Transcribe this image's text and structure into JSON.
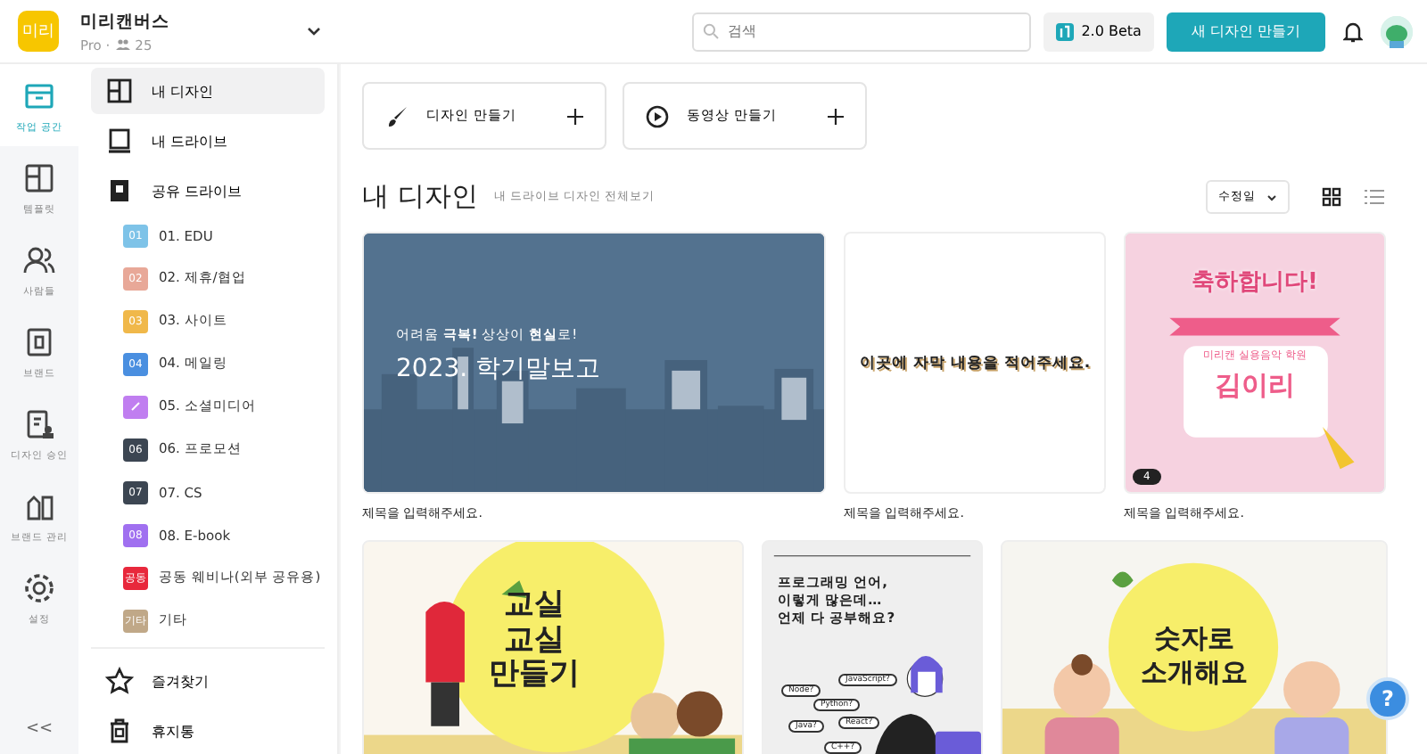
{
  "workspace": {
    "logo": "미리",
    "name": "미리캔버스",
    "plan": "Pro ·",
    "members": "25"
  },
  "header": {
    "search_placeholder": "검색",
    "beta_label": "2.0 Beta",
    "new_design_label": "새 디자인 만들기"
  },
  "rail": [
    {
      "kind": "workspace",
      "label": "작업 공간",
      "selected": true
    },
    {
      "kind": "template",
      "label": "템플릿",
      "selected": false
    },
    {
      "kind": "people",
      "label": "사람들",
      "selected": false
    },
    {
      "kind": "brand",
      "label": "브랜드",
      "selected": false
    },
    {
      "kind": "approval",
      "label": "디자인 승인",
      "selected": false
    },
    {
      "kind": "brandmgmt",
      "label": "브랜드 관리",
      "selected": false
    },
    {
      "kind": "settings",
      "label": "설정",
      "selected": false
    }
  ],
  "rail_collapse": "<<",
  "sidebar": {
    "items": [
      {
        "kind": "design",
        "label": "내 디자인",
        "selected": true
      },
      {
        "kind": "drive",
        "label": "내 드라이브",
        "selected": false
      },
      {
        "kind": "shared",
        "label": "공유 드라이브",
        "selected": false,
        "children": [
          {
            "code": "01",
            "label": "01. EDU",
            "color": "#7ec3e8"
          },
          {
            "code": "02",
            "label": "02. 제휴/협업",
            "color": "#e8a898"
          },
          {
            "code": "03",
            "label": "03. 사이트",
            "color": "#f0b84a"
          },
          {
            "code": "04",
            "label": "04. 메일링",
            "color": "#4a8fe0"
          },
          {
            "label": "05. 소셜미디어",
            "color": "#c07ef0"
          },
          {
            "code": "06",
            "label": "06. 프로모션",
            "color": "#3c4652"
          },
          {
            "code": "07",
            "label": "07. CS",
            "color": "#3c4652"
          },
          {
            "code": "08",
            "label": "08. E-book",
            "color": "#a070f0"
          },
          {
            "code": "공동",
            "label": "공동 웨비나(외부 공유용)",
            "color": "#e8283c"
          },
          {
            "code": "기타",
            "label": "기타",
            "color": "#c0a888"
          }
        ]
      },
      {
        "kind": "favorite",
        "label": "즐겨찾기",
        "selected": false
      },
      {
        "kind": "trash",
        "label": "휴지통",
        "selected": false
      }
    ]
  },
  "create_buttons": [
    {
      "kind": "design",
      "label": "디자인 만들기"
    },
    {
      "kind": "video",
      "label": "동영상 만들기"
    }
  ],
  "section": {
    "title": "내 디자인",
    "link": "내 드라이브 디자인 전체보기",
    "sort": "수정일",
    "views": [
      {
        "kind": "grid",
        "selected": true
      },
      {
        "kind": "list",
        "selected": false
      }
    ]
  },
  "designs": [
    {
      "kind": "report",
      "lines": [
        "어려움 **극복!** 상상이 **현실**로!",
        "2023. 학기말보고"
      ],
      "caption": "제목을 입력해주세요."
    },
    {
      "kind": "subtitle",
      "lines": [
        "이곳에 자막 내용을 적어주세요."
      ],
      "caption": "제목을 입력해주세요."
    },
    {
      "kind": "congrats",
      "lines": [
        "축하합니다!",
        "미리캔 실용음악 학원",
        "김이리"
      ],
      "badge": "4",
      "caption": "제목을 입력해주세요."
    },
    {
      "kind": "classroom",
      "lines": [
        "교실",
        "교실",
        "만들기"
      ]
    },
    {
      "kind": "programming",
      "lines": [
        "프로그래밍 언어,",
        "이렇게 많은데…",
        "언제 다 공부해요?"
      ],
      "tags": [
        "Node?",
        "JavaScript?",
        "Python?",
        "Java?",
        "React?",
        "C++?"
      ]
    },
    {
      "kind": "numbers",
      "lines": [
        "숫자로",
        "소개해요"
      ]
    }
  ],
  "help_label": "?"
}
